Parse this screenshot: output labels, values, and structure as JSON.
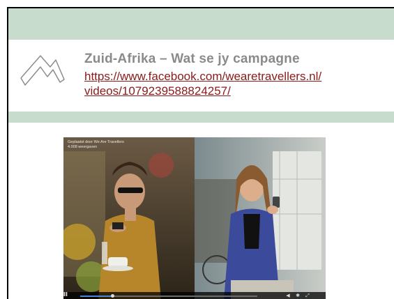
{
  "slide": {
    "title": "Zuid-Afrika – Wat se jy campagne",
    "link_line1": "https://www.facebook.com/wearetravellers.nl/",
    "link_line2": "videos/1079239588824257/",
    "icon": "house-outline-icon",
    "accent_color": "#c7dccc",
    "link_color": "#8b1a1a"
  },
  "video": {
    "posted_by_prefix": "Geplaatst door ",
    "posted_by": "We Are Travellers",
    "views": "4.008 weergaven",
    "progress": 0.18,
    "icons": [
      "play-icon",
      "volume-icon",
      "settings-icon",
      "fullscreen-icon"
    ]
  }
}
